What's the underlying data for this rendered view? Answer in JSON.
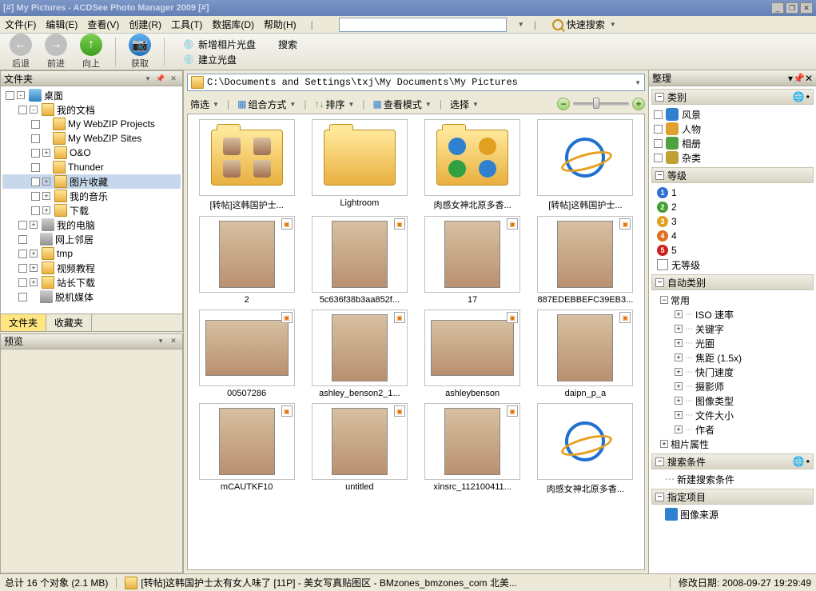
{
  "title": "[#] My Pictures - ACDSee Photo Manager 2009 [#]",
  "menu": [
    "文件(F)",
    "编辑(E)",
    "查看(V)",
    "创建(R)",
    "工具(T)",
    "数据库(D)",
    "帮助(H)"
  ],
  "quick_search": "快速搜索",
  "nav": {
    "back": "后退",
    "forward": "前进",
    "up": "向上",
    "get": "获取"
  },
  "toolbar_sub": {
    "new_disc": "新增相片光盘",
    "create_disc": "建立光盘",
    "search": "搜索"
  },
  "left": {
    "folders_label": "文件夹",
    "fav_label": "收藏夹",
    "preview_label": "预览",
    "tree": [
      {
        "ind": 0,
        "exp": "-",
        "ico": "desktop",
        "t": "桌面"
      },
      {
        "ind": 1,
        "exp": "-",
        "ico": "folder",
        "t": "我的文档"
      },
      {
        "ind": 2,
        "exp": "",
        "ico": "folder",
        "t": "My WebZIP Projects"
      },
      {
        "ind": 2,
        "exp": "",
        "ico": "folder",
        "t": "My WebZIP Sites"
      },
      {
        "ind": 2,
        "exp": "+",
        "ico": "folder",
        "t": "O&O"
      },
      {
        "ind": 2,
        "exp": "",
        "ico": "folder",
        "t": "Thunder"
      },
      {
        "ind": 2,
        "exp": "+",
        "ico": "folder",
        "t": "图片收藏",
        "sel": true
      },
      {
        "ind": 2,
        "exp": "+",
        "ico": "folder",
        "t": "我的音乐"
      },
      {
        "ind": 2,
        "exp": "+",
        "ico": "folder",
        "t": "下载"
      },
      {
        "ind": 1,
        "exp": "+",
        "ico": "comp",
        "t": "我的电脑"
      },
      {
        "ind": 1,
        "exp": "",
        "ico": "comp",
        "t": "网上邻居"
      },
      {
        "ind": 1,
        "exp": "+",
        "ico": "folder",
        "t": "tmp"
      },
      {
        "ind": 1,
        "exp": "+",
        "ico": "folder",
        "t": "视频教程"
      },
      {
        "ind": 1,
        "exp": "+",
        "ico": "folder",
        "t": "站长下载"
      },
      {
        "ind": 1,
        "exp": "",
        "ico": "comp",
        "t": "脱机媒体"
      }
    ]
  },
  "address": "C:\\Documents and Settings\\txj\\My Documents\\My Pictures",
  "viewbar": {
    "filter": "筛选",
    "group": "组合方式",
    "sort": "排序",
    "viewmode": "查看模式",
    "select": "选择"
  },
  "thumbs": [
    {
      "type": "folder-shapes",
      "label": "[转帖]这韩国护士..."
    },
    {
      "type": "folder",
      "label": "Lightroom"
    },
    {
      "type": "folder-icons",
      "label": "肉感女神北原多香..."
    },
    {
      "type": "ie",
      "label": "[转帖]这韩国护士..."
    },
    {
      "type": "photo",
      "label": "2",
      "orient": "tall"
    },
    {
      "type": "photo",
      "label": "5c636f38b3aa852f...",
      "orient": "tall"
    },
    {
      "type": "photo",
      "label": "17",
      "orient": "tall"
    },
    {
      "type": "photo",
      "label": "887EDEBBEFC39EB3...",
      "orient": "tall"
    },
    {
      "type": "photo",
      "label": "00507286",
      "orient": "wide"
    },
    {
      "type": "photo",
      "label": "ashley_benson2_1...",
      "orient": "tall"
    },
    {
      "type": "photo",
      "label": "ashleybenson",
      "orient": "wide"
    },
    {
      "type": "photo",
      "label": "daipn_p_a",
      "orient": "tall"
    },
    {
      "type": "photo",
      "label": "mCAUTKF10",
      "orient": "tall"
    },
    {
      "type": "photo",
      "label": "untitled",
      "orient": "tall"
    },
    {
      "type": "photo",
      "label": "xinsrc_112100411...",
      "orient": "tall"
    },
    {
      "type": "ie",
      "label": "肉感女神北原多香..."
    }
  ],
  "right": {
    "title": "整理",
    "cat_label": "类别",
    "categories": [
      {
        "t": "风景",
        "color": "#3080d0"
      },
      {
        "t": "人物",
        "color": "#e0a030"
      },
      {
        "t": "相册",
        "color": "#50a040"
      },
      {
        "t": "杂类",
        "color": "#c0a030"
      }
    ],
    "rating_label": "等级",
    "ratings": [
      {
        "n": "1",
        "c": "#3070d0"
      },
      {
        "n": "2",
        "c": "#40a030"
      },
      {
        "n": "3",
        "c": "#e0a020"
      },
      {
        "n": "4",
        "c": "#e07020"
      },
      {
        "n": "5",
        "c": "#d02020"
      }
    ],
    "no_rating": "无等级",
    "auto_label": "自动类别",
    "common": "常用",
    "auto_items": [
      "ISO 速率",
      "关键字",
      "光圈",
      "焦距 (1.5x)",
      "快门速度",
      "摄影师",
      "图像类型",
      "文件大小",
      "作者"
    ],
    "photo_attrs": "相片属性",
    "search_cond": "搜索条件",
    "new_search": "新建搜索条件",
    "spec_items": "指定项目",
    "img_source": "图像来源"
  },
  "status": {
    "total": "总计 16 个对象 (2.1 MB)",
    "path": "[转帖]这韩国护士太有女人味了 [11P] - 美女写真贴图区 - BMzones_bmzones_com 北美...",
    "modified": "修改日期: 2008-09-27 19:29:49"
  }
}
